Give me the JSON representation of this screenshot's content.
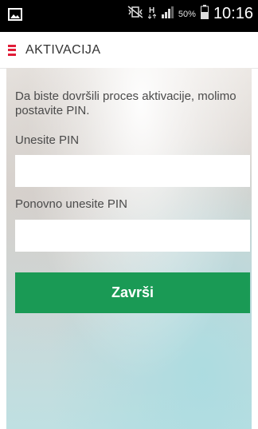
{
  "status_bar": {
    "icons": [
      "image-icon",
      "mute-vibrate-icon",
      "hplus-data-icon",
      "signal-icon",
      "battery-icon"
    ],
    "network_label": "H",
    "battery_percent": "50%",
    "time": "10:16"
  },
  "app_bar": {
    "title": "AKTIVACIJA",
    "accent_color": "#e11d38"
  },
  "form": {
    "intro_text": "Da biste dovršili proces aktivacije, molimo postavite PIN.",
    "pin_label": "Unesite PIN",
    "pin_value": "",
    "pin_confirm_label": "Ponovno unesite PIN",
    "pin_confirm_value": "",
    "submit_label": "Završi",
    "submit_color": "#1a9a55"
  }
}
